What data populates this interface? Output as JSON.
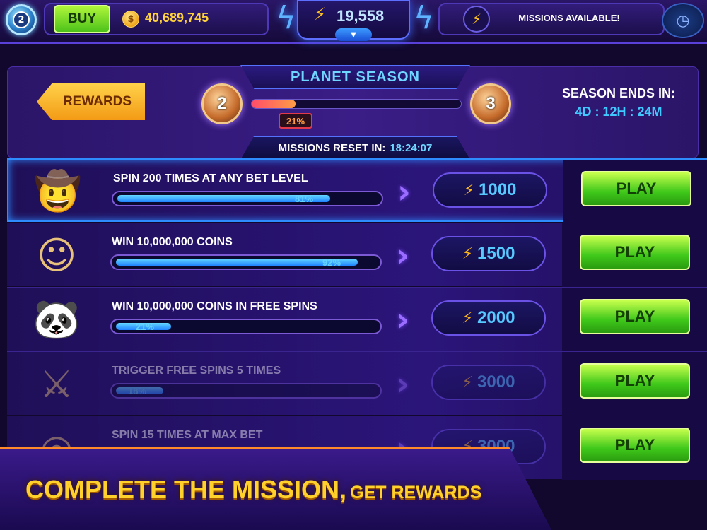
{
  "header": {
    "level": "2",
    "buy_label": "BUY",
    "coin_symbol": "$",
    "coins": "40,689,745",
    "energy": "19,558",
    "missions_available": "MISSIONS AVAILABLE!"
  },
  "season": {
    "title": "PLANET SEASON",
    "rewards_label": "REWARDS",
    "current_level": "2",
    "next_level": "3",
    "progress_fraction": 0.21,
    "progress_label": "21%",
    "ends_label": "SEASON ENDS IN:",
    "ends_value": "4D : 12H : 24M",
    "reset_label": "MISSIONS RESET IN:",
    "reset_value": "18:24:07"
  },
  "missions": [
    {
      "title": "SPIN 200 TIMES AT ANY BET LEVEL",
      "progress": 0.81,
      "progress_label": "81%",
      "reward": "1000",
      "play_label": "PLAY",
      "avatar": "cowboy-avatar",
      "status": "active"
    },
    {
      "title": "WIN 10,000,000 COINS",
      "progress": 0.92,
      "progress_label": "92%",
      "reward": "1500",
      "play_label": "PLAY",
      "avatar": "buddha-avatar",
      "status": "normal"
    },
    {
      "title": "WIN 10,000,000 COINS IN FREE SPINS",
      "progress": 0.21,
      "progress_label": "21%",
      "reward": "2000",
      "play_label": "PLAY",
      "avatar": "panda-avatar",
      "status": "normal"
    },
    {
      "title": "TRIGGER FREE SPINS 5 TIMES",
      "progress": 0.18,
      "progress_label": "18%",
      "reward": "3000",
      "play_label": "PLAY",
      "avatar": "warrior-avatar",
      "status": "dim"
    },
    {
      "title": "SPIN 15 TIMES AT MAX BET",
      "reward": "3000",
      "play_label": "PLAY",
      "avatar": "dreamcatcher-avatar",
      "status": "dim"
    }
  ],
  "banner": {
    "big": "COMPLETE THE MISSION,",
    "small": "GET REWARDS"
  },
  "colors": {
    "accent_blue": "#56c9ff",
    "play_green": "#3fc81a",
    "rewards_gold": "#f39a16",
    "banner_gold": "#ffd12a"
  }
}
